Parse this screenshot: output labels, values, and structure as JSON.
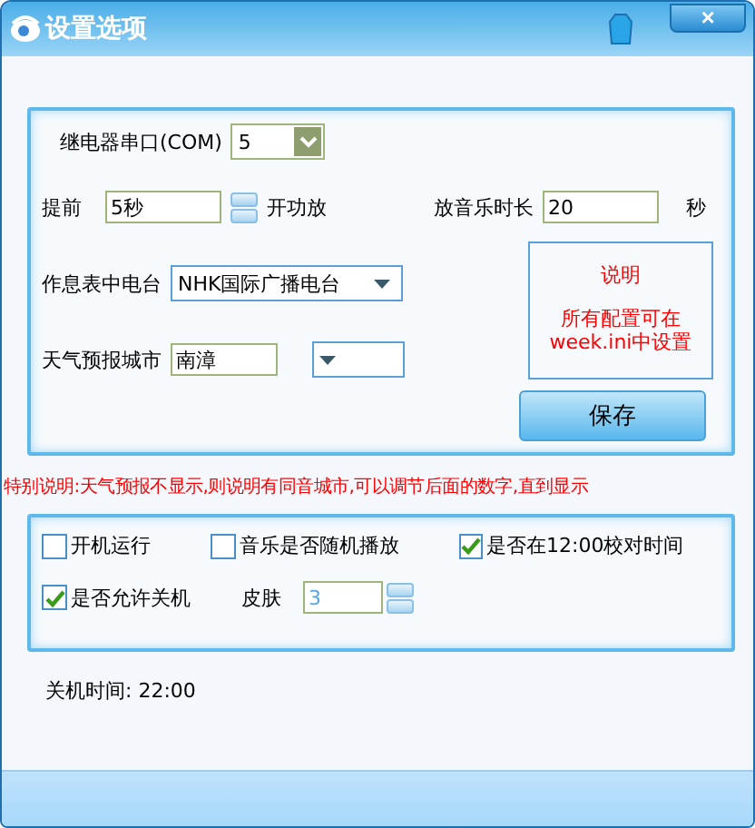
{
  "window": {
    "title": "设置选项",
    "close": "×"
  },
  "settings": {
    "com_label": "继电器串口(COM)",
    "com_value": "5",
    "advance_label": "提前",
    "advance_value": "5秒",
    "advance_suffix": "开功放",
    "music_label": "放音乐时长",
    "music_value": "20",
    "music_unit": "秒",
    "station_label": "作息表中电台",
    "station_value": "NHK国际广播电台",
    "city_label": "天气预报城市",
    "city_value": "南漳",
    "note": {
      "title": "说明",
      "lines": [
        "所有配置可在",
        "week.ini中设置"
      ]
    },
    "save_button": "保存"
  },
  "special_note": "特别说明:天气预报不显示,则说明有同音城市,可以调节后面的数字,直到显示",
  "options": [
    {
      "label": "开机运行",
      "checked": false
    },
    {
      "label": "音乐是否随机播放",
      "checked": false
    },
    {
      "label": "是否在12:00校对时间",
      "checked": true
    },
    {
      "label": "是否允许关机",
      "checked": true
    }
  ],
  "skin": {
    "label": "皮肤",
    "value": "3",
    "disabled": true
  },
  "shutdown_time": "关机时间: 22:00"
}
